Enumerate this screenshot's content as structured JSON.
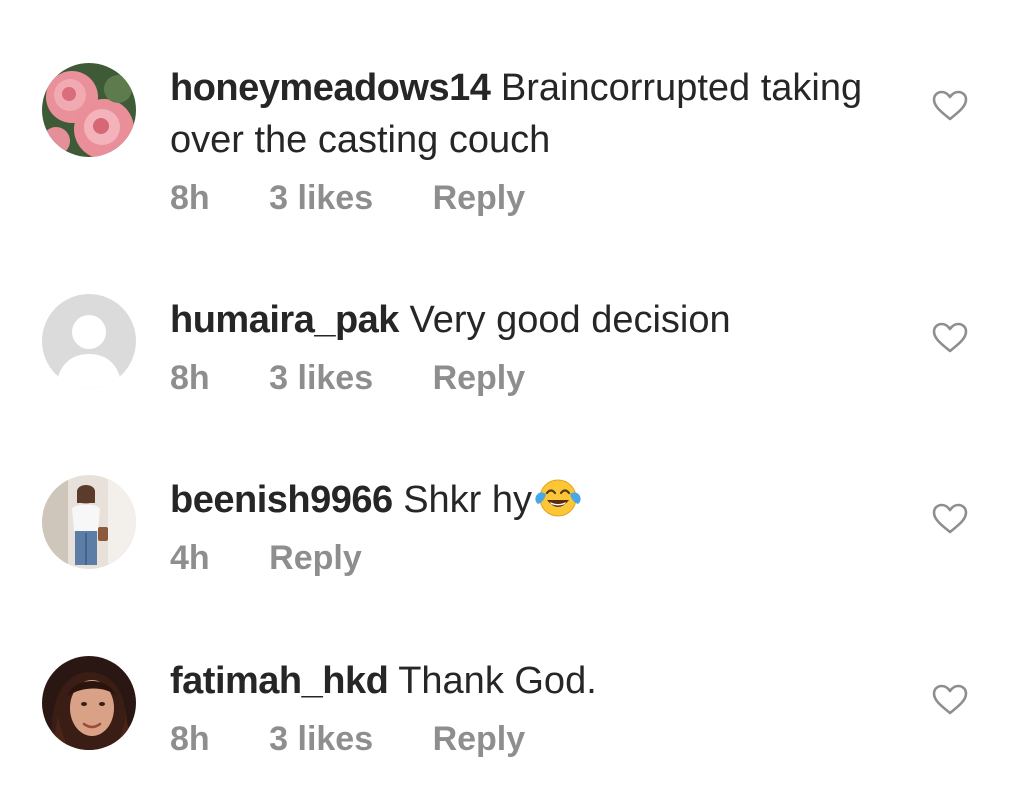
{
  "comments": [
    {
      "username": "honeymeadows14",
      "text": "Braincorrupted taking over the casting couch",
      "time": "8h",
      "likes": "3 likes",
      "reply": "Reply",
      "avatar_icon": "pink-roses-avatar"
    },
    {
      "username": "humaira_pak",
      "text": "Very good decision",
      "time": "8h",
      "likes": "3 likes",
      "reply": "Reply",
      "avatar_icon": "default-user-avatar"
    },
    {
      "username": "beenish9966",
      "text": "Shkr hy",
      "emoji": "face-with-tears-of-joy",
      "time": "4h",
      "reply": "Reply",
      "avatar_icon": "photo-avatar"
    },
    {
      "username": "fatimah_hkd",
      "text": "Thank God.",
      "time": "8h",
      "likes": "3 likes",
      "reply": "Reply",
      "avatar_icon": "photo-avatar"
    }
  ],
  "colors": {
    "text": "#262626",
    "meta": "#8e8e8e",
    "heart": "#8e8e8e"
  }
}
